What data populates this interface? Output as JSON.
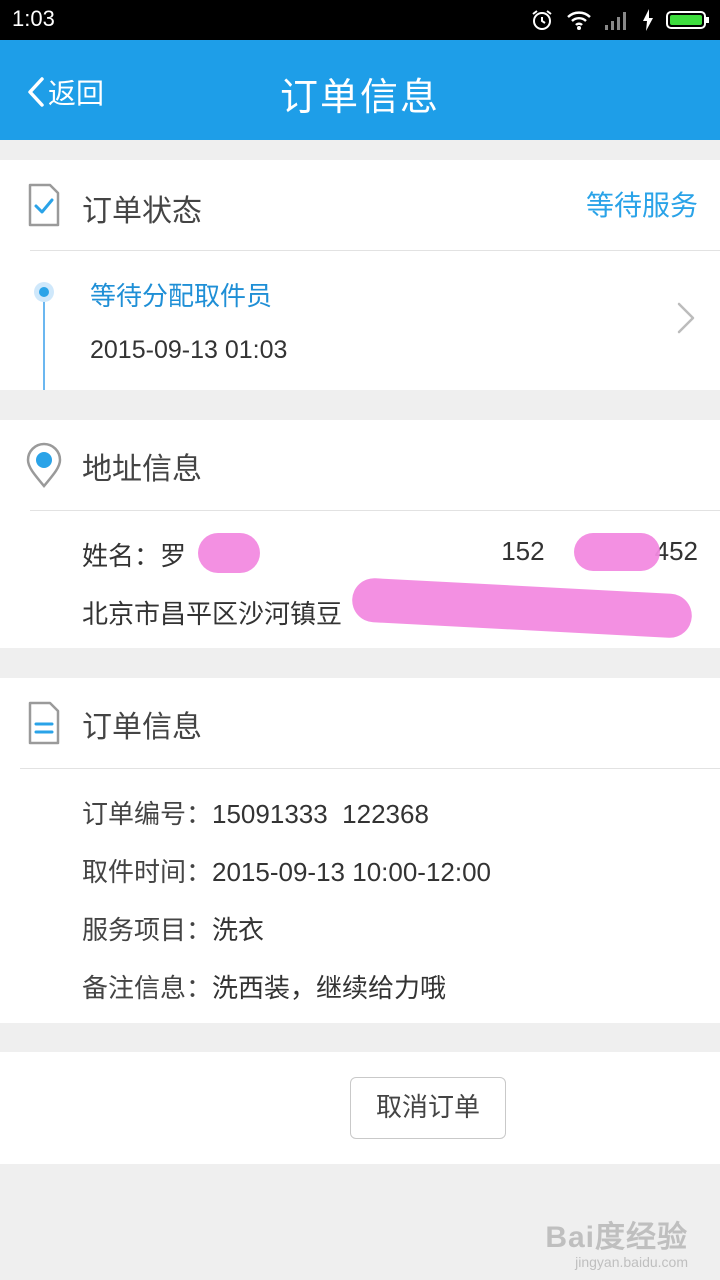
{
  "status_bar": {
    "time": "1:03"
  },
  "header": {
    "back_label": "返回",
    "title": "订单信息"
  },
  "order_status": {
    "section_title": "订单状态",
    "status": "等待服务",
    "latest_step": {
      "label": "等待分配取件员",
      "time": "2015-09-13 01:03"
    }
  },
  "address": {
    "section_title": "地址信息",
    "name_label": "姓名：罗",
    "phone_visible_prefix": "152",
    "phone_visible_suffix": "452",
    "address_visible": "北京市昌平区沙河镇豆"
  },
  "order_info": {
    "section_title": "订单信息",
    "rows": [
      {
        "key": "订单编号：",
        "value": "15091333  122368"
      },
      {
        "key": "取件时间：",
        "value": "2015-09-13 10:00-12:00"
      },
      {
        "key": "服务项目：",
        "value": "洗衣"
      },
      {
        "key": "备注信息：",
        "value": "洗西装，继续给力哦"
      }
    ]
  },
  "actions": {
    "cancel_label": "取消订单"
  },
  "watermark": {
    "main": "Bai度经验",
    "sub": "jingyan.baidu.com"
  },
  "colors": {
    "header_bg": "#1e9ee8",
    "accent": "#2aa3e8",
    "redaction": "#f28ae0"
  }
}
